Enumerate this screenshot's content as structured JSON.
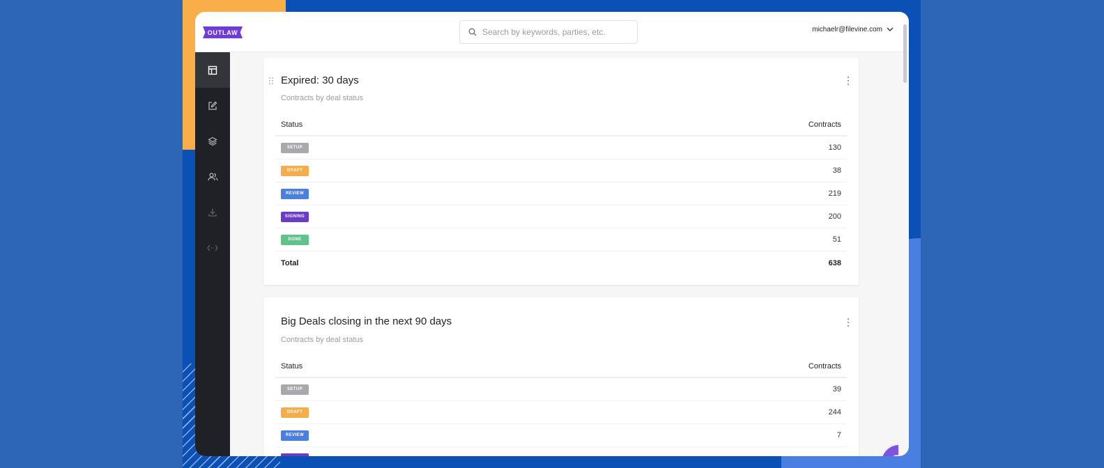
{
  "app": {
    "logo_text": "OUTLAW",
    "search_placeholder": "Search by keywords, parties, etc.",
    "user_email": "michaelr@filevine.com"
  },
  "colors": {
    "setup": "#a9a9ad",
    "draft": "#f5ad4c",
    "review": "#4a7fe0",
    "signing": "#6a3cc8",
    "done": "#5fc38b",
    "brand": "#6f3cd8"
  },
  "sidebar": {
    "items": [
      {
        "icon": "dashboard-icon",
        "active": true
      },
      {
        "icon": "edit-icon"
      },
      {
        "icon": "layers-icon"
      },
      {
        "icon": "users-icon"
      },
      {
        "icon": "download-icon"
      },
      {
        "icon": "code-icon"
      }
    ]
  },
  "cards": [
    {
      "title": "Expired: 30 days",
      "subtitle": "Contracts by deal status",
      "col_status": "Status",
      "col_contracts": "Contracts",
      "rows": [
        {
          "status": "SETUP",
          "count": "130"
        },
        {
          "status": "DRAFT",
          "count": "38"
        },
        {
          "status": "REVIEW",
          "count": "219"
        },
        {
          "status": "SIGNING",
          "count": "200"
        },
        {
          "status": "DONE",
          "count": "51"
        }
      ],
      "total_label": "Total",
      "total": "638"
    },
    {
      "title": "Big Deals closing in the next 90 days",
      "subtitle": "Contracts by deal status",
      "col_status": "Status",
      "col_contracts": "Contracts",
      "rows": [
        {
          "status": "SETUP",
          "count": "39"
        },
        {
          "status": "DRAFT",
          "count": "244"
        },
        {
          "status": "REVIEW",
          "count": "7"
        }
      ]
    }
  ]
}
